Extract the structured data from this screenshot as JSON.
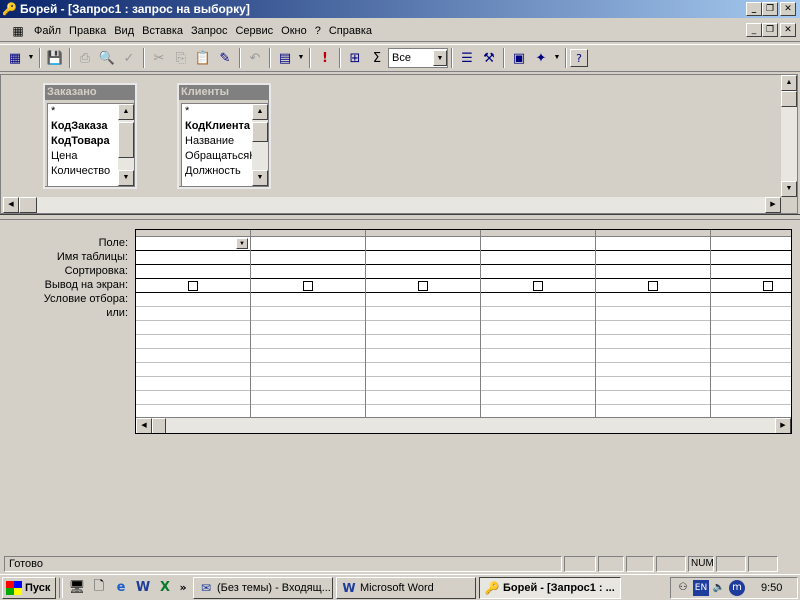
{
  "window": {
    "title": "Борей - [Запрос1 : запрос на выборку]",
    "app_icon": "key-icon"
  },
  "menu": [
    "Файл",
    "Правка",
    "Вид",
    "Вставка",
    "Запрос",
    "Сервис",
    "Окно",
    "?",
    "Справка"
  ],
  "toolbar": {
    "top_values": "Все",
    "buttons": [
      "view-icon",
      "save-icon",
      "print-icon",
      "print-preview-icon",
      "spelling-icon",
      "cut-icon",
      "copy-icon",
      "paste-icon",
      "format-painter-icon",
      "undo-icon",
      "query-type-icon",
      "run-icon",
      "show-table-icon",
      "totals-icon",
      "properties-icon",
      "build-icon",
      "database-window-icon",
      "new-object-icon",
      "help-icon"
    ]
  },
  "tables": [
    {
      "name": "Заказано",
      "fields": [
        {
          "label": "*",
          "bold": false
        },
        {
          "label": "КодЗаказа",
          "bold": true
        },
        {
          "label": "КодТовара",
          "bold": true
        },
        {
          "label": "Цена",
          "bold": false
        },
        {
          "label": "Количество",
          "bold": false
        }
      ]
    },
    {
      "name": "Клиенты",
      "fields": [
        {
          "label": "*",
          "bold": false
        },
        {
          "label": "КодКлиента",
          "bold": true
        },
        {
          "label": "Название",
          "bold": false
        },
        {
          "label": "ОбращатьсяК",
          "bold": false
        },
        {
          "label": "Должность",
          "bold": false
        }
      ]
    }
  ],
  "grid": {
    "row_labels": [
      "Поле:",
      "Имя таблицы:",
      "Сортировка:",
      "Вывод на экран:",
      "Условие отбора:",
      "или:"
    ],
    "column_count": 6
  },
  "status": {
    "text": "Готово",
    "indicator": "NUM"
  },
  "taskbar": {
    "start_label": "Пуск",
    "quick_launch": [
      "show-desktop-icon",
      "notepad-icon",
      "internet-explorer-icon",
      "word-icon",
      "excel-icon"
    ],
    "more": "»",
    "tasks": [
      {
        "label": "(Без темы) - Входящ...",
        "icon": "mail-icon",
        "active": false
      },
      {
        "label": "Microsoft Word",
        "icon": "word-icon",
        "active": false
      },
      {
        "label": "Борей - [Запрос1 : ...",
        "icon": "key-icon",
        "active": true
      }
    ],
    "lang": "EN",
    "clock": "9:50"
  }
}
